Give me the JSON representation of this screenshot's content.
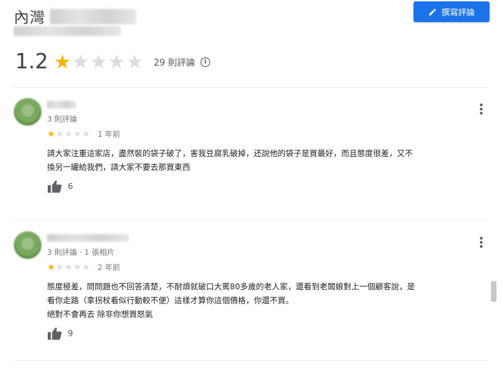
{
  "header": {
    "place_name": "內灣",
    "write_review_label": "撰寫評論"
  },
  "summary": {
    "rating": "1.2",
    "stars_filled": 1,
    "stars_total": 5,
    "review_count": "29 則評論"
  },
  "reviews": [
    {
      "meta": "3 則評論",
      "stars_filled": 1,
      "time": "1 年前",
      "text_lines": [
        "請大家注重這家店，盡然裝的袋子破了，害我豆腐乳破掉，还說他的袋子是買最好，而且態度很差，又不",
        "換另一罐給我們，請大家不要去那買東西"
      ],
      "likes": "6"
    },
    {
      "meta": "3 則評論 · 1 張相片",
      "stars_filled": 1,
      "time": "2 年前",
      "text_lines": [
        "態度極差，問問題也不回答清楚，不耐煩就破口大罵80多歲的老人家，還看到老闆娘對上一個顧客說，是",
        "看你走路（拿拐杖看似行動較不便）這樣才算你這個價格，你還不買。",
        "絕對不會再去 除非你想買怒氣"
      ],
      "likes": "9"
    }
  ],
  "colors": {
    "accent": "#1a73e8",
    "star": "#f4b400",
    "star_empty": "#dadce0"
  },
  "icons": {
    "write": "pencil-icon",
    "info": "info-icon",
    "more": "more-vert-icon",
    "like": "thumb-up-icon"
  }
}
